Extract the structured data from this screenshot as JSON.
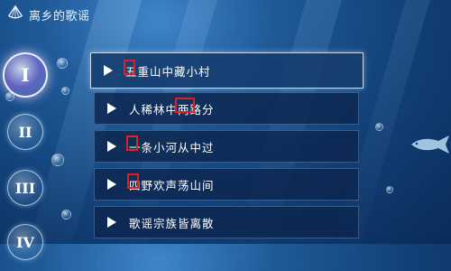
{
  "header": {
    "title": "离乡的歌谣",
    "icon": "shell-icon"
  },
  "chapters": [
    {
      "label": "I",
      "active": true
    },
    {
      "label": "II",
      "active": false
    },
    {
      "label": "III",
      "active": false
    },
    {
      "label": "IV",
      "active": false
    }
  ],
  "songs": [
    {
      "title": "五重山中藏小村",
      "active": true
    },
    {
      "title": "人稀林中两路分",
      "active": false
    },
    {
      "title": "一条小河从中过",
      "active": false
    },
    {
      "title": "四野欢声荡山间",
      "active": false
    },
    {
      "title": "歌谣宗族皆离散",
      "active": false
    }
  ],
  "colors": {
    "highlight_box": "#e02020",
    "background": "#1f5a98"
  }
}
